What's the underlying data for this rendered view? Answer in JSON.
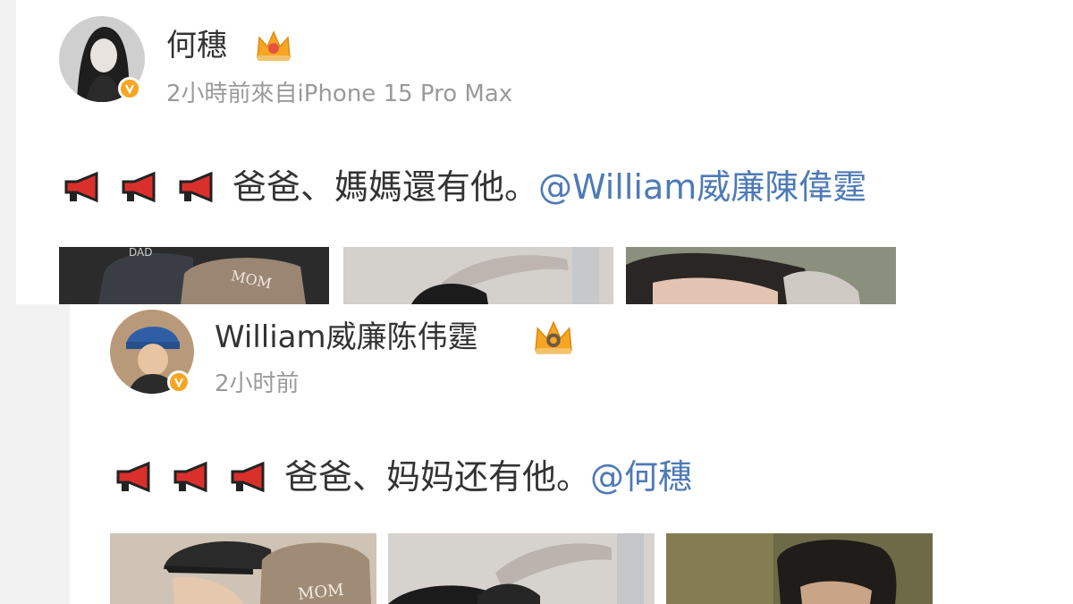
{
  "posts": [
    {
      "username": "何穗",
      "meta": "2小時前來自iPhone 15 Pro Max",
      "text": "爸爸、媽媽還有他。",
      "mention": "@William威廉陳偉霆",
      "horn_icons": [
        "megaphone-icon",
        "megaphone-icon",
        "megaphone-icon"
      ],
      "photos": [
        {
          "caption_cap_left": "DAD",
          "caption_cap_right": "MOM"
        },
        {},
        {}
      ],
      "accent": "#4e7ab6",
      "crown_color": "#f6a623"
    },
    {
      "username": "William威廉陈伟霆",
      "meta": "2小时前",
      "text": "爸爸、妈妈还有他。",
      "mention": "@何穗",
      "horn_icons": [
        "megaphone-icon",
        "megaphone-icon",
        "megaphone-icon"
      ],
      "photos": [
        {
          "caption_cap_right": "MOM"
        },
        {},
        {}
      ],
      "accent": "#4e7ab6",
      "crown_color": "#f6a623"
    }
  ]
}
